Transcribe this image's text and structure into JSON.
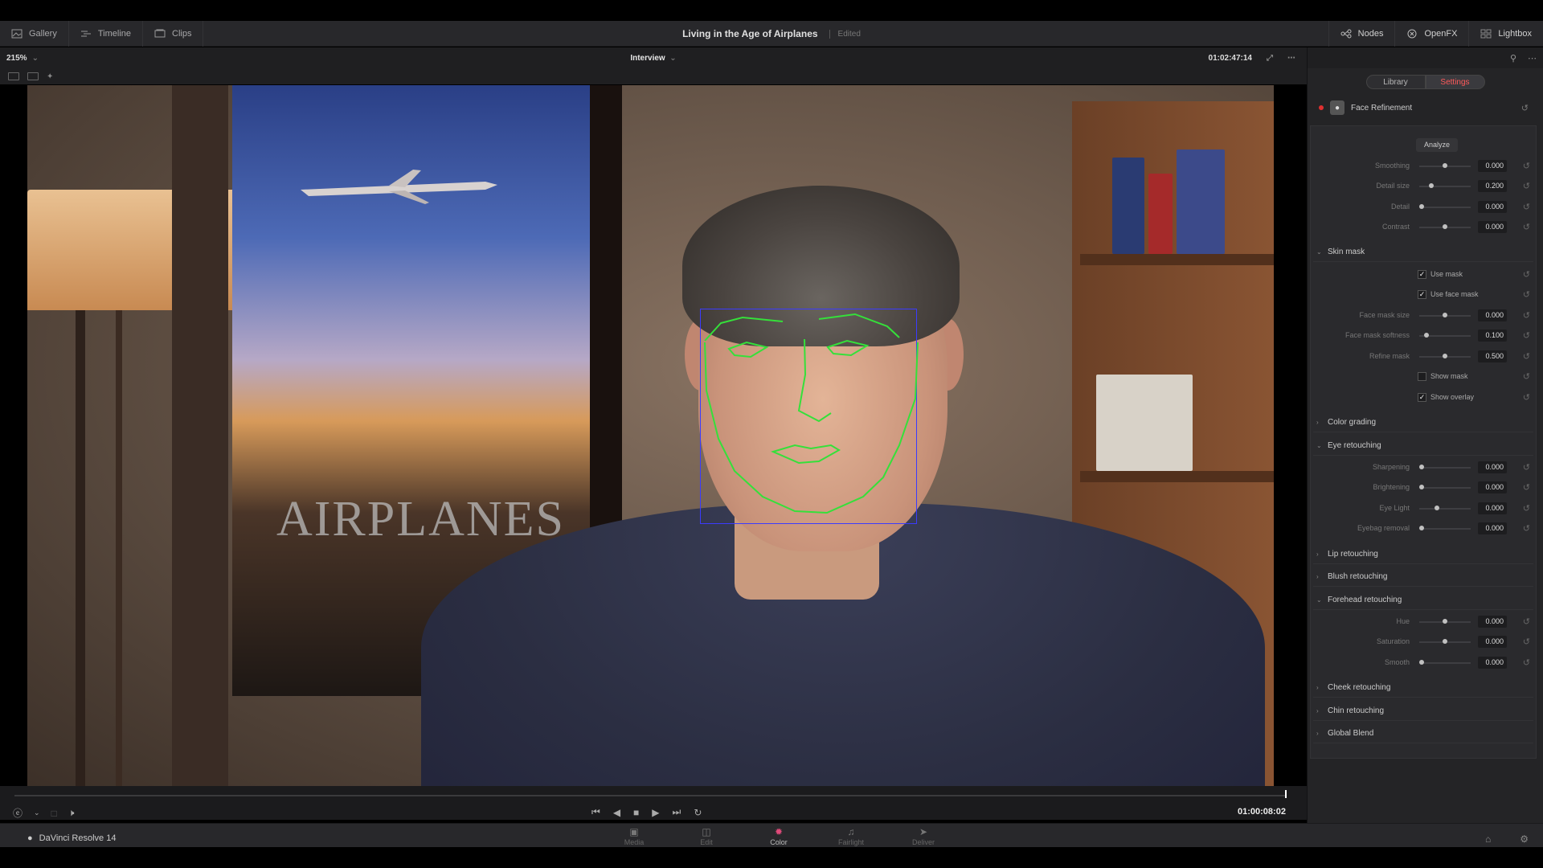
{
  "topbar": {
    "gallery": "Gallery",
    "timeline": "Timeline",
    "clips": "Clips",
    "project_title": "Living in the Age of Airplanes",
    "status": "Edited",
    "nodes": "Nodes",
    "openfx": "OpenFX",
    "lightbox": "Lightbox"
  },
  "viewer": {
    "zoom": "215%",
    "clip_name": "Interview",
    "timecode": "01:02:47:14",
    "poster_text": "AIRPLANES"
  },
  "transport": {
    "timecode": "01:00:08:02"
  },
  "appbar": {
    "app_name": "DaVinci Resolve 14",
    "pages": [
      {
        "label": "Media",
        "icon": "media-icon"
      },
      {
        "label": "Edit",
        "icon": "edit-icon"
      },
      {
        "label": "Color",
        "icon": "color-icon"
      },
      {
        "label": "Fairlight",
        "icon": "fairlight-icon"
      },
      {
        "label": "Deliver",
        "icon": "deliver-icon"
      }
    ],
    "active_page": "Color"
  },
  "panel": {
    "tabs": [
      "Library",
      "Settings"
    ],
    "active_tab": "Settings",
    "effect_name": "Face Refinement",
    "analyze_label": "Analyze",
    "params_main": [
      {
        "label": "Smoothing",
        "value": "0.000",
        "level": 0.5
      },
      {
        "label": "Detail size",
        "value": "0.200",
        "level": 0.2
      },
      {
        "label": "Detail",
        "value": "0.000",
        "level": 0.0
      },
      {
        "label": "Contrast",
        "value": "0.000",
        "level": 0.5
      }
    ],
    "skin_mask": {
      "title": "Skin mask",
      "use_mask": {
        "label": "Use mask",
        "checked": true
      },
      "use_face_mask": {
        "label": "Use face mask",
        "checked": true
      },
      "params": [
        {
          "label": "Face mask size",
          "value": "0.000",
          "level": 0.5
        },
        {
          "label": "Face mask softness",
          "value": "0.100",
          "level": 0.1
        },
        {
          "label": "Refine mask",
          "value": "0.500",
          "level": 0.5
        }
      ],
      "show_mask": {
        "label": "Show mask",
        "checked": false
      },
      "show_overlay": {
        "label": "Show overlay",
        "checked": true
      }
    },
    "color_grading": "Color grading",
    "eye_retouching": {
      "title": "Eye retouching",
      "params": [
        {
          "label": "Sharpening",
          "value": "0.000",
          "level": 0.0
        },
        {
          "label": "Brightening",
          "value": "0.000",
          "level": 0.0
        },
        {
          "label": "Eye Light",
          "value": "0.000",
          "level": 0.33
        },
        {
          "label": "Eyebag removal",
          "value": "0.000",
          "level": 0.0
        }
      ]
    },
    "lip_retouching": "Lip retouching",
    "blush_retouching": "Blush retouching",
    "forehead_retouching": {
      "title": "Forehead retouching",
      "params": [
        {
          "label": "Hue",
          "value": "0.000",
          "level": 0.5
        },
        {
          "label": "Saturation",
          "value": "0.000",
          "level": 0.5
        },
        {
          "label": "Smooth",
          "value": "0.000",
          "level": 0.0
        }
      ]
    },
    "cheek_retouching": "Cheek retouching",
    "chin_retouching": "Chin retouching",
    "global_blend": "Global Blend"
  }
}
